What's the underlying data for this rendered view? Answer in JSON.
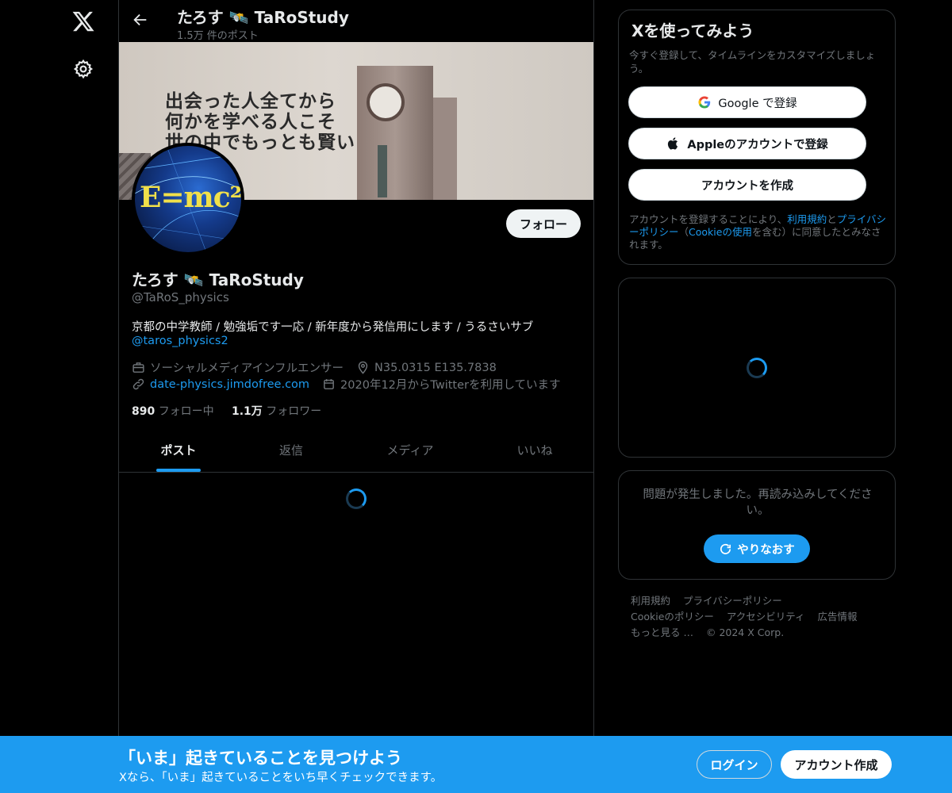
{
  "nav": {
    "logo_icon": "x-logo-icon",
    "settings_icon": "gear-icon"
  },
  "header": {
    "name": "たろす 🛰️ TaRoStudy",
    "post_count": "1.5万 件のポスト"
  },
  "banner": {
    "line1": "出会った人全てから",
    "line2": "何かを学べる人こそ",
    "line3": "世の中でもっとも賢い"
  },
  "avatar": {
    "formula": "E=mc²"
  },
  "profile": {
    "follow_label": "フォロー",
    "name": "たろす 🛰️ TaRoStudy",
    "handle": "@TaRoS_physics",
    "bio": "京都の中学教師 / 勉強垢です一応 / 新年度から発信用にします / うるさいサブ",
    "bio_mention": "@taros_physics2",
    "profession": "ソーシャルメディアインフルエンサー",
    "location": "N35.0315 E135.7838",
    "website": "date-physics.jimdofree.com",
    "joined": "2020年12月からTwitterを利用しています",
    "following_count": "890",
    "following_label": "フォロー中",
    "followers_count": "1.1万",
    "followers_label": "フォロワー"
  },
  "tabs": [
    {
      "label": "ポスト",
      "active": true
    },
    {
      "label": "返信",
      "active": false
    },
    {
      "label": "メディア",
      "active": false
    },
    {
      "label": "いいね",
      "active": false
    }
  ],
  "signup": {
    "title": "Xを使ってみよう",
    "subtitle": "今すぐ登録して、タイムラインをカスタマイズしましょう。",
    "google_label": "Google で登録",
    "apple_label": "Appleのアカウントで登録",
    "create_label": "アカウントを作成",
    "terms_pre": "アカウントを登録することにより、",
    "terms_link": "利用規約",
    "terms_and": "と",
    "privacy_link": "プライバシーポリシー",
    "terms_paren_open": "（",
    "cookie_link": "Cookieの使用",
    "terms_post": "を含む）に同意したとみなされます。"
  },
  "error": {
    "message": "問題が発生しました。再読み込みしてください。",
    "retry_label": "やりなおす"
  },
  "footer": {
    "links": [
      "利用規約",
      "プライバシーポリシー",
      "Cookieのポリシー",
      "アクセシビリティ",
      "広告情報",
      "もっと見る …",
      "© 2024 X Corp."
    ]
  },
  "bottom_bar": {
    "title": "「いま」起きていることを見つけよう",
    "subtitle": "Xなら、「いま」起きていることをいち早くチェックできます。",
    "login_label": "ログイン",
    "create_label": "アカウント作成"
  },
  "colors": {
    "accent": "#1d9bf0",
    "background": "#000000",
    "text": "#e7e9ea",
    "muted": "#71767b",
    "border": "#2f3336"
  }
}
